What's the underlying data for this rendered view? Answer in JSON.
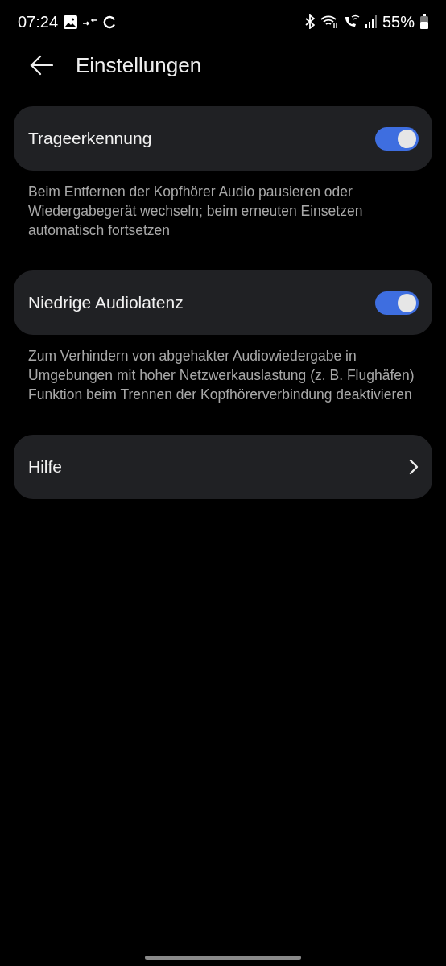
{
  "status_bar": {
    "time": "07:24",
    "battery": "55%"
  },
  "header": {
    "title": "Einstellungen"
  },
  "items": [
    {
      "kind": "switch",
      "label": "Trageerkennung",
      "on": true,
      "description": "Beim Entfernen der Kopfhörer Audio pausieren oder Wiedergabegerät wechseln; beim erneuten Einsetzen automatisch fortsetzen"
    },
    {
      "kind": "switch",
      "label": "Niedrige Audiolatenz",
      "on": true,
      "description": "Zum Verhindern von abgehakter Audiowiedergabe in Umgebungen mit hoher Netzwerkauslastung (z. B. Flughäfen) Funktion beim Trennen der Kopfhörerverbindung deaktivieren"
    },
    {
      "kind": "link",
      "label": "Hilfe"
    }
  ]
}
